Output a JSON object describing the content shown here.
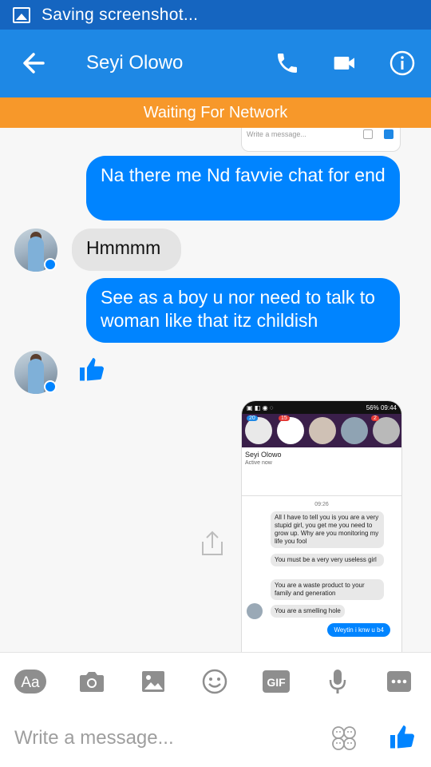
{
  "status_bar": {
    "text": "Saving screenshot..."
  },
  "header": {
    "title": "Seyi Olowo"
  },
  "banner": {
    "text": "Waiting For Network"
  },
  "conversation": {
    "cut_card_input": "Write a message...",
    "messages": [
      {
        "from": "me",
        "text": "Na there me Nd favvie chat for end"
      },
      {
        "from": "them",
        "text": "Hmmmm"
      },
      {
        "from": "me",
        "text": "See as a boy u nor need to talk to woman like that itz childish"
      },
      {
        "from": "them",
        "type": "like"
      }
    ],
    "shared_screenshot": {
      "status_right": "56% 09:44",
      "badges": [
        "20",
        "15",
        "2"
      ],
      "contact_name": "Seyi Olowo",
      "contact_status": "Active now",
      "time": "09:26",
      "messages": [
        "All I have to tell you is you are a very stupid girl, you get me you need to grow up. Why are you monitoring my life you fool",
        "You must be a very very useless girl",
        "You are a waste product to your family and generation",
        "You are a smelling hole"
      ],
      "reply": "Weytin i knw u b4"
    }
  },
  "toolbar": {
    "aa_label": "Aa",
    "gif_label": "GIF"
  },
  "composer": {
    "placeholder": "Write a message..."
  },
  "colors": {
    "status_bar": "#1565c0",
    "app_bar": "#1e88e5",
    "banner": "#f7982a",
    "outgoing_bubble": "#0084ff",
    "incoming_bubble": "#e4e4e4"
  }
}
